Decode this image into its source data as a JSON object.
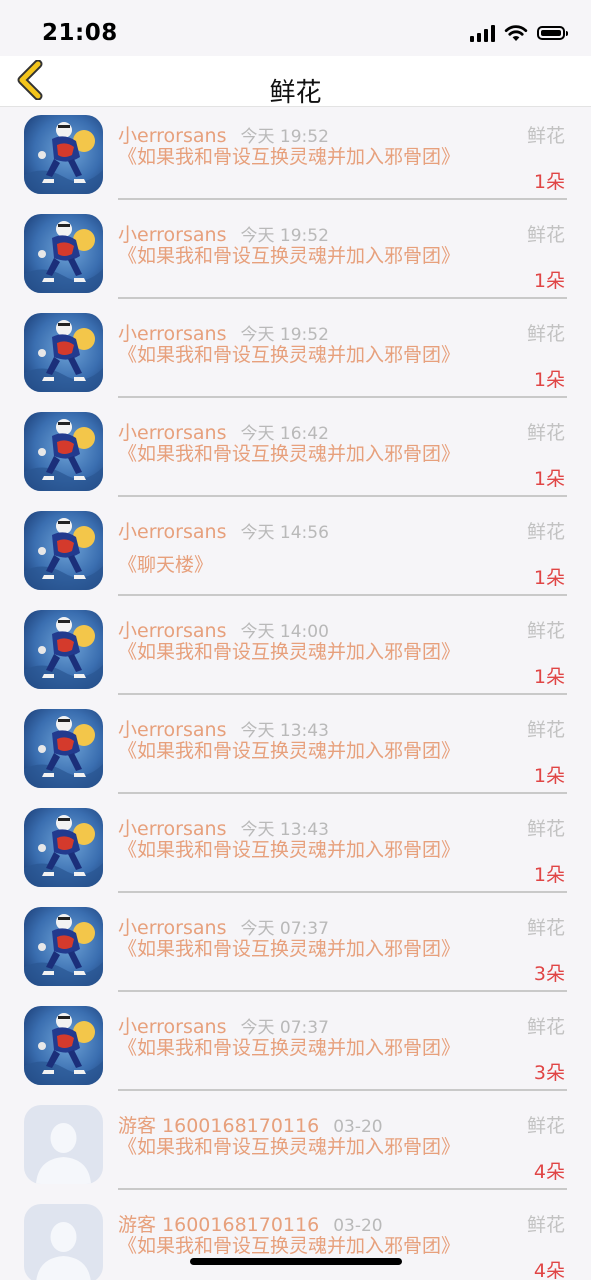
{
  "status_bar": {
    "time": "21:08"
  },
  "nav": {
    "title": "鲜花"
  },
  "rows": [
    {
      "avatar": "character",
      "user": "小errorsans",
      "time": "今天 19:52",
      "type": "鲜花",
      "title": "《如果我和骨设互换灵魂并加入邪骨团》",
      "count": "1朵"
    },
    {
      "avatar": "character",
      "user": "小errorsans",
      "time": "今天 19:52",
      "type": "鲜花",
      "title": "《如果我和骨设互换灵魂并加入邪骨团》",
      "count": "1朵"
    },
    {
      "avatar": "character",
      "user": "小errorsans",
      "time": "今天 19:52",
      "type": "鲜花",
      "title": "《如果我和骨设互换灵魂并加入邪骨团》",
      "count": "1朵"
    },
    {
      "avatar": "character",
      "user": "小errorsans",
      "time": "今天 16:42",
      "type": "鲜花",
      "title": "《如果我和骨设互换灵魂并加入邪骨团》",
      "count": "1朵"
    },
    {
      "avatar": "character",
      "user": "小errorsans",
      "time": "今天 14:56",
      "type": "鲜花",
      "title": "《聊天楼》",
      "count": "1朵"
    },
    {
      "avatar": "character",
      "user": "小errorsans",
      "time": "今天 14:00",
      "type": "鲜花",
      "title": "《如果我和骨设互换灵魂并加入邪骨团》",
      "count": "1朵"
    },
    {
      "avatar": "character",
      "user": "小errorsans",
      "time": "今天 13:43",
      "type": "鲜花",
      "title": "《如果我和骨设互换灵魂并加入邪骨团》",
      "count": "1朵"
    },
    {
      "avatar": "character",
      "user": "小errorsans",
      "time": "今天 13:43",
      "type": "鲜花",
      "title": "《如果我和骨设互换灵魂并加入邪骨团》",
      "count": "1朵"
    },
    {
      "avatar": "character",
      "user": "小errorsans",
      "time": "今天 07:37",
      "type": "鲜花",
      "title": "《如果我和骨设互换灵魂并加入邪骨团》",
      "count": "3朵"
    },
    {
      "avatar": "character",
      "user": "小errorsans",
      "time": "今天 07:37",
      "type": "鲜花",
      "title": "《如果我和骨设互换灵魂并加入邪骨团》",
      "count": "3朵"
    },
    {
      "avatar": "default",
      "user": "游客 1600168170116",
      "time": "03-20",
      "type": "鲜花",
      "title": "《如果我和骨设互换灵魂并加入邪骨团》",
      "count": "4朵"
    },
    {
      "avatar": "default",
      "user": "游客 1600168170116",
      "time": "03-20",
      "type": "鲜花",
      "title": "《如果我和骨设互换灵魂并加入邪骨团》",
      "count": "4朵"
    }
  ],
  "colors": {
    "accent": "#e7a07c",
    "count": "#e04545",
    "muted": "#c2c2c2",
    "back_arrow": "#f4c51c"
  },
  "icons": {
    "back": "chevron-left-icon",
    "signal": "cellular-signal-icon",
    "wifi": "wifi-icon",
    "battery": "battery-icon"
  }
}
